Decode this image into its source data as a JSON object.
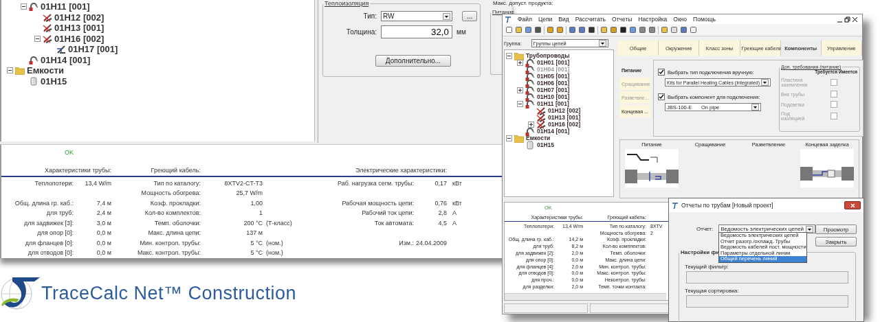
{
  "back_window": {
    "tree": [
      {
        "children": [
          {
            "label": "01H11 [001]",
            "kind": "circuit",
            "expanded": true,
            "children": [
              {
                "label": "01H12 [002]",
                "kind": "segment-crossed"
              },
              {
                "label": "01H13 [001]",
                "kind": "segment-crossed"
              },
              {
                "label": "01H16 [002]",
                "kind": "segment-crossed",
                "expanded": true,
                "children": [
                  {
                    "label": "01H17 [001]",
                    "kind": "segment"
                  }
                ]
              }
            ]
          },
          {
            "label": "01H14 [001]",
            "kind": "circuit"
          }
        ]
      },
      {
        "label": "Емкости",
        "kind": "folder",
        "expanded": true,
        "children": [
          {
            "label": "01H15",
            "kind": "tank"
          }
        ]
      }
    ],
    "insulation": {
      "legend": "Теплоизоляция",
      "type_label": "Тип:",
      "type_value": "RW",
      "browse_button": "...",
      "thickness_label": "Толщина:",
      "thickness_value": "32,0",
      "thickness_unit": "мм",
      "more_button": "Дополнительно..."
    },
    "side_panel": {
      "max_product_label": "Макс. допуст. продукта:",
      "power_legend": "Питание"
    },
    "results": {
      "status": "OK",
      "pipe_header": "Характеристики трубы:",
      "cable_header": "Греющий кабель:",
      "electric_header": "Электрические характеристики:",
      "rows": [
        {
          "pipe_label": "Теплопотери:",
          "pipe_value": "13,4 W/m",
          "cable_label": "Тип по каталогу:",
          "cable_value": "8XTV2-CT-T3",
          "electric_label": "Раб. нагрузка сегм. трубы:",
          "electric_value": "0,17",
          "electric_unit": "кВт"
        },
        {
          "cable_label": "Мощность обогрева:",
          "cable_value": "25,7 W/m"
        },
        {
          "pipe_label": "Общ. длина гр. каб.:",
          "pipe_value": "7,4 м",
          "cable_label": "Коэф. прокладки:",
          "cable_value": "1,00",
          "electric_label": "Рабочая мощность цепи:",
          "electric_value": "0,76",
          "electric_unit": "кВт"
        },
        {
          "pipe_label": "для труб:",
          "pipe_value": "2,4 м",
          "cable_label": "Кол-во комплектов:",
          "cable_value": "1",
          "electric_label": "Рабочий ток цепи:",
          "electric_value": "2,8",
          "electric_unit": "А"
        },
        {
          "pipe_label": "для задвижек [3]:",
          "pipe_value": "3,0 м",
          "cable_label": "Темп. оболочки:",
          "cable_value": "200 °C",
          "cable_note": "(Т-класс)",
          "electric_label": "Ток автомата:",
          "electric_value": "4,5",
          "electric_unit": "А"
        },
        {
          "pipe_label": "для опор [0]:",
          "pipe_value": "0,0 м",
          "cable_label": "Макс. длина цепи:",
          "cable_value": "137 м"
        },
        {
          "pipe_label": "для фланцев [0]:",
          "pipe_value": "0,0 м",
          "cable_label": "Мин. контрол. трубы:",
          "cable_value": "5 °C",
          "cable_note": "(ном.)",
          "electric_label": "Изм.:",
          "electric_value": "24.04.2009"
        },
        {
          "pipe_label": "для отводов [0]:",
          "pipe_value": "0,0 м",
          "cable_label": "Макс. контрол. трубы:",
          "cable_value": "5 °C",
          "cable_note": "(ном.)"
        }
      ]
    }
  },
  "main_window": {
    "menu": [
      "Файл",
      "Цепи",
      "Вид",
      "Рассчитать",
      "Отчеты",
      "Настройка",
      "Окно",
      "Помощь"
    ],
    "group_label": "Группа:",
    "group_value": "Группы цепей",
    "tree": [
      {
        "label": "Трубопроводы",
        "kind": "folder",
        "expanded": true,
        "disabled": false,
        "children": [
          {
            "label": "01H01 [001]",
            "kind": "circuit",
            "expanded": false,
            "disabled": false
          },
          {
            "label": "01H04 [001]",
            "kind": "circuit",
            "disabled": true
          },
          {
            "label": "01H05 [001]",
            "kind": "circuit",
            "disabled": false
          },
          {
            "label": "01H06 [001]",
            "kind": "circuit",
            "disabled": false
          },
          {
            "label": "01H07 [001]",
            "kind": "circuit",
            "expanded": false,
            "disabled": false
          },
          {
            "label": "01H10 [001]",
            "kind": "circuit",
            "disabled": false
          },
          {
            "label": "01H11 [001]",
            "kind": "circuit",
            "expanded": true,
            "disabled": false,
            "children": [
              {
                "label": "01H12 [002]",
                "kind": "segment-crossed",
                "disabled": false
              },
              {
                "label": "01H13 [001]",
                "kind": "segment-crossed",
                "disabled": false
              },
              {
                "label": "01H16 [002]",
                "kind": "segment-crossed",
                "expanded": false,
                "disabled": false
              }
            ]
          },
          {
            "label": "01H14 [001]",
            "kind": "circuit",
            "disabled": false
          }
        ]
      },
      {
        "label": "Емкости",
        "kind": "folder",
        "expanded": true,
        "disabled": false,
        "children": [
          {
            "label": "01H15",
            "kind": "tank",
            "disabled": false
          }
        ]
      }
    ],
    "tabs": [
      {
        "label": "Общие",
        "selected": false
      },
      {
        "label": "Окружение",
        "selected": false
      },
      {
        "label": "Класс зоны",
        "selected": false
      },
      {
        "label": "Греющие кабели",
        "selected": false
      },
      {
        "label": "Компоненты",
        "selected": true
      },
      {
        "label": "Управление",
        "selected": false
      }
    ],
    "side_tabs": [
      {
        "label": "Питание",
        "selected": true,
        "disabled": false
      },
      {
        "label": "Сращивание",
        "selected": false,
        "disabled": true
      },
      {
        "label": "Разветвле...",
        "selected": false,
        "disabled": true
      },
      {
        "label": "Концевая ...",
        "selected": false,
        "disabled": false
      }
    ],
    "connection": {
      "type_checkbox": {
        "label": "Выбрать тип подключения вручную:",
        "checked": true
      },
      "type_value": "Kits for Parallel Heating Cables (Integrated)",
      "component_checkbox": {
        "label": "Выбрать компонент для подключения:",
        "checked": true
      },
      "component_value": "JBS-100-E",
      "component_place": "On pipe"
    },
    "extra": {
      "legend": "Доп. требования (питание)",
      "required_header": "Требуется",
      "present_header": "Имеется",
      "rows": [
        {
          "label": "Пластина заземления",
          "checked": false,
          "disabled": true
        },
        {
          "label": "Вне трубы",
          "checked": false,
          "disabled": true
        },
        {
          "label": "Подсветка",
          "checked": false,
          "disabled": true
        },
        {
          "label": "Под изоляцией",
          "checked": false,
          "disabled": true
        }
      ]
    },
    "preview": [
      {
        "label": "Питание",
        "kind": "power"
      },
      {
        "label": "Сращивание",
        "kind": "empty"
      },
      {
        "label": "Разветвление",
        "kind": "empty"
      },
      {
        "label": "Концевая заделка",
        "kind": "end-seal"
      }
    ],
    "results": {
      "status": "OK",
      "pipe_header": "Характеристики трубы:",
      "cable_header": "Греющий кабель:",
      "rows": [
        {
          "pipe_label": "Теплопотери:",
          "pipe_value": "13,4 W/m",
          "cable_label": "Тип по каталогу:",
          "cable_value": "8XTV"
        },
        {
          "cable_label": "Мощность обогрева:",
          "cable_value": "2"
        },
        {
          "pipe_label": "Общ. длина гр. каб.:",
          "pipe_value": "14,2 м",
          "cable_label": "Коэф. прокладки:"
        },
        {
          "pipe_label": "для труб:",
          "pipe_value": "8,2 м",
          "cable_label": "Кол-во комплектов:"
        },
        {
          "pipe_label": "для задвижек [2]:",
          "pipe_value": "2,0 м",
          "cable_label": "Темп. оболочки:"
        },
        {
          "pipe_label": "для опор [0]:",
          "pipe_value": "0,0 м",
          "cable_label": "Макс. длина цепи:"
        },
        {
          "pipe_label": "для фланцев [4]:",
          "pipe_value": "2,0 м",
          "cable_label": "Мин. контрол. трубы:"
        },
        {
          "pipe_label": "для отводов [0]:",
          "pipe_value": "0,0 м",
          "cable_label": "Макс. контрол. трубы:"
        },
        {
          "pipe_label": "для проч.:",
          "pipe_value": "0,0 м",
          "cable_label": "Неконтрол. трубы:"
        },
        {
          "pipe_label": "для разделки:",
          "pipe_value": "2,0 м",
          "cable_label": "Темп. точки контакта:"
        }
      ]
    }
  },
  "report_dialog": {
    "title": "Отчеты по трубам [Новый проект]",
    "report_label": "Отчет:",
    "report_value": "Ведомость электрических цепей",
    "options": [
      {
        "label": "Ведомость электрических цепей",
        "selected": false
      },
      {
        "label": "Отчет разогр./охлажд. Трубы",
        "selected": false
      },
      {
        "label": "Ведомость кабелей пост. мощности",
        "selected": false
      },
      {
        "label": "Параметры отдельной линии",
        "selected": false
      },
      {
        "label": "Общий перечень линий",
        "selected": true
      }
    ],
    "preview_button": "Просмотр",
    "close_button": "Закрыть",
    "settings_legend": "Настройки фи",
    "filter_label": "Текущий фильтр:",
    "sort_label": "Текущая сортировка:"
  },
  "logo": {
    "text": "TraceCalc Net™ Construction"
  }
}
